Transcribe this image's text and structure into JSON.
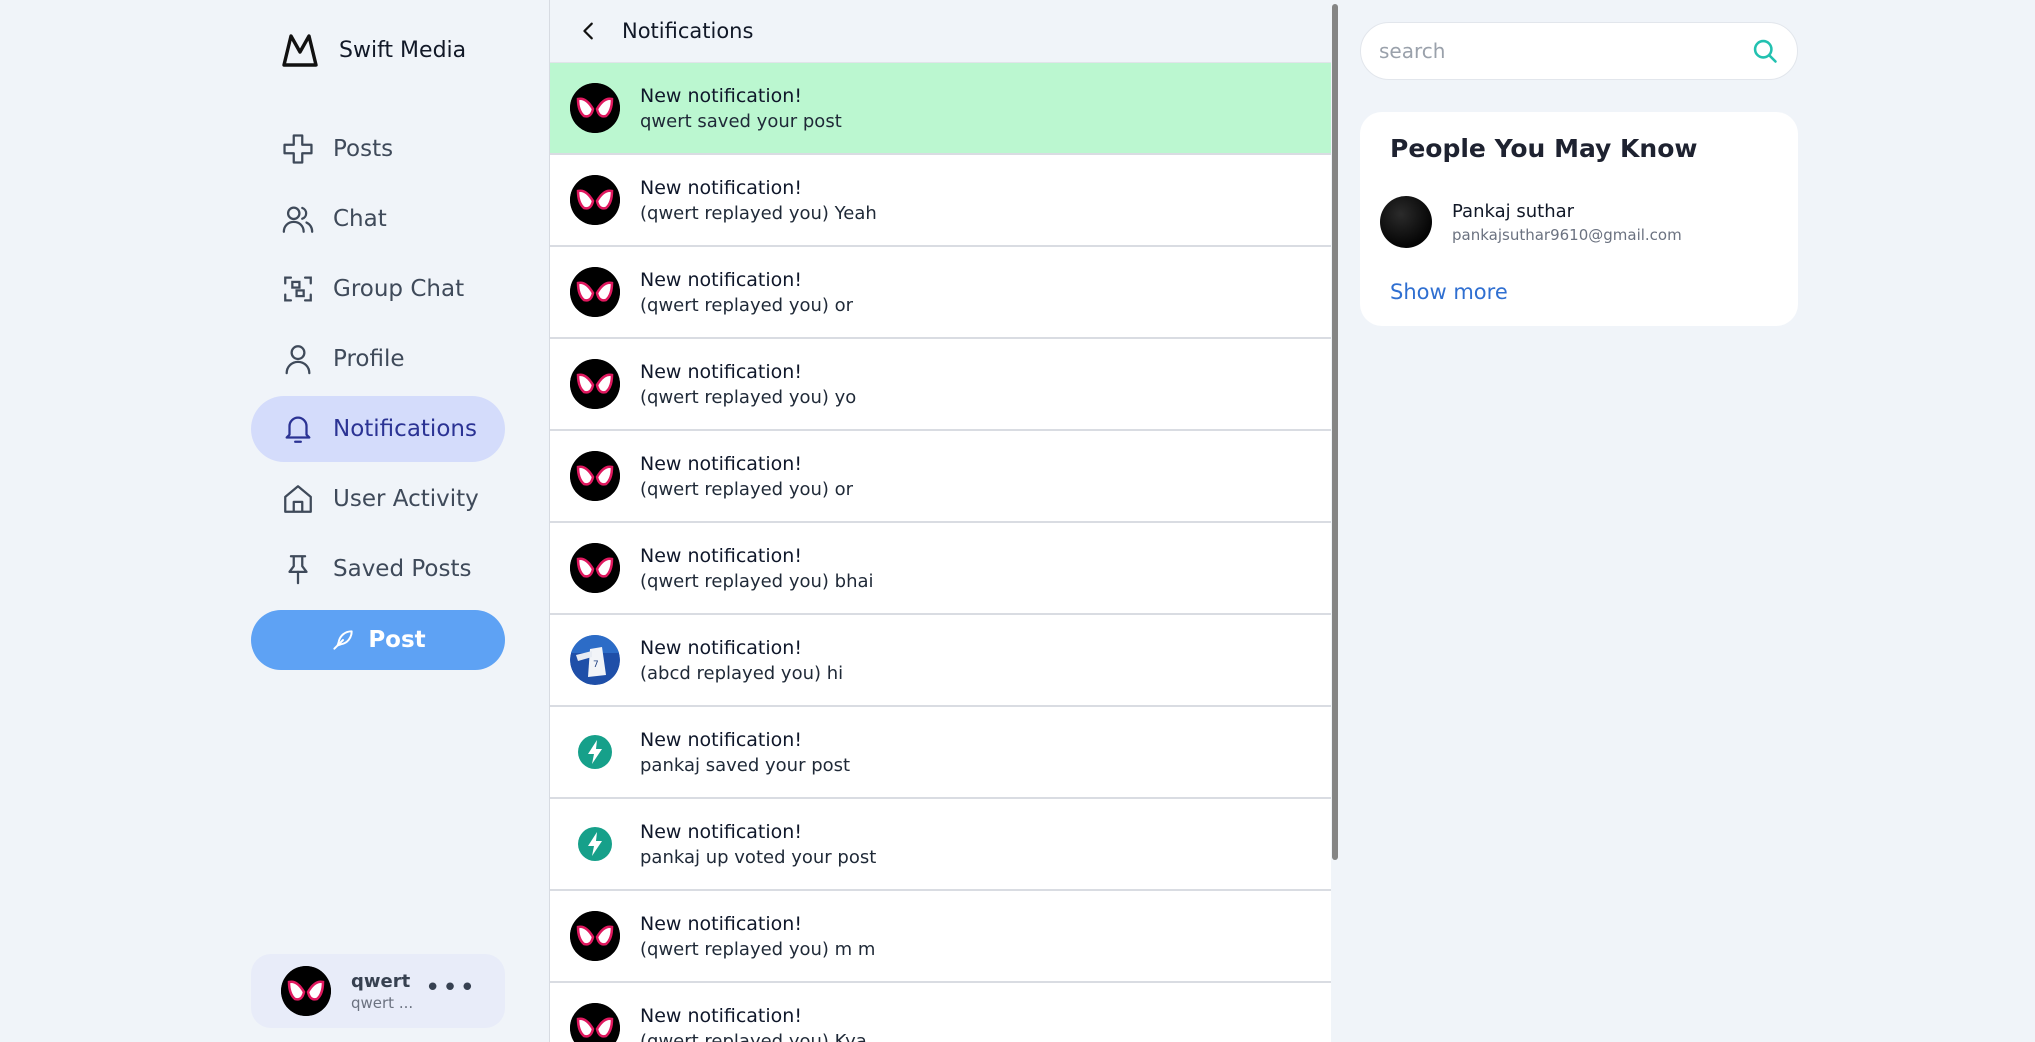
{
  "brand": {
    "name": "Swift Media",
    "icon": "crown-mountain-logo"
  },
  "nav": {
    "items": [
      {
        "label": "Posts",
        "icon": "plus-cross-icon"
      },
      {
        "label": "Chat",
        "icon": "users-icon"
      },
      {
        "label": "Group Chat",
        "icon": "group-frame-icon"
      },
      {
        "label": "Profile",
        "icon": "user-icon"
      },
      {
        "label": "Notifications",
        "icon": "bell-icon",
        "active": true
      },
      {
        "label": "User Activity",
        "icon": "home-icon"
      },
      {
        "label": "Saved Posts",
        "icon": "pin-icon"
      }
    ],
    "post_button": "Post"
  },
  "current_user": {
    "name": "qwert",
    "handle": "qwert ...",
    "menu": "•••"
  },
  "header": {
    "title": "Notifications"
  },
  "notifications": [
    {
      "title": "New notification!",
      "body": "qwert saved your post",
      "avatar": "spidey",
      "highlight": true
    },
    {
      "title": "New notification!",
      "body": "(qwert replayed you) Yeah",
      "avatar": "spidey"
    },
    {
      "title": "New notification!",
      "body": "(qwert replayed you) or",
      "avatar": "spidey"
    },
    {
      "title": "New notification!",
      "body": "(qwert replayed you) yo",
      "avatar": "spidey"
    },
    {
      "title": "New notification!",
      "body": "(qwert replayed you) or",
      "avatar": "spidey"
    },
    {
      "title": "New notification!",
      "body": "(qwert replayed you) bhai",
      "avatar": "spidey"
    },
    {
      "title": "New notification!",
      "body": "(abcd replayed you) hi",
      "avatar": "photo"
    },
    {
      "title": "New notification!",
      "body": "pankaj saved your post",
      "avatar": "bolt"
    },
    {
      "title": "New notification!",
      "body": "pankaj up voted your post",
      "avatar": "bolt"
    },
    {
      "title": "New notification!",
      "body": "(qwert replayed you) m m",
      "avatar": "spidey"
    },
    {
      "title": "New notification!",
      "body": "(qwert replayed you) Kya",
      "avatar": "spidey"
    }
  ],
  "search": {
    "placeholder": "search"
  },
  "people_you_may_know": {
    "heading": "People You May Know",
    "people": [
      {
        "name": "Pankaj suthar",
        "email": "pankajsuthar9610@gmail.com"
      }
    ],
    "show_more": "Show more"
  },
  "colors": {
    "accent": "#5ea2f4",
    "active_nav_bg": "#d4dcfb",
    "highlight": "#bbf7d0",
    "link": "#2f6fd1",
    "search_icon": "#22c1b0"
  }
}
